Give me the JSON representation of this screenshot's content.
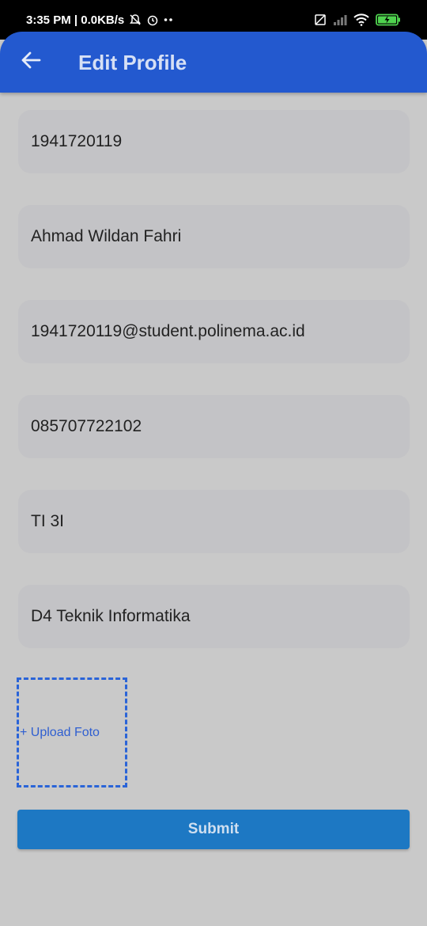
{
  "status_bar": {
    "time_speed": "3:35 PM | 0.0KB/s",
    "icons": [
      "mute-bell-icon",
      "alarm-icon",
      "more-dots-icon",
      "no-sim-icon",
      "signal-icon",
      "wifi-icon",
      "battery-charging-icon"
    ]
  },
  "appbar": {
    "title": "Edit Profile",
    "back_icon": "arrow-left-icon",
    "color": "#2359cf"
  },
  "form": {
    "fields": [
      {
        "name": "nim",
        "value": "1941720119"
      },
      {
        "name": "name",
        "value": "Ahmad Wildan Fahri"
      },
      {
        "name": "email",
        "value": "1941720119@student.polinema.ac.id"
      },
      {
        "name": "phone",
        "value": "085707722102"
      },
      {
        "name": "class",
        "value": "TI 3I"
      },
      {
        "name": "major",
        "value": "D4 Teknik Informatika"
      }
    ],
    "upload_label": "+ Upload Foto",
    "submit_label": "Submit"
  },
  "colors": {
    "background": "#c9c9c9",
    "field_bg": "#c3c3c6",
    "accent": "#2a64d8",
    "submit_bg": "#1d78c3"
  }
}
